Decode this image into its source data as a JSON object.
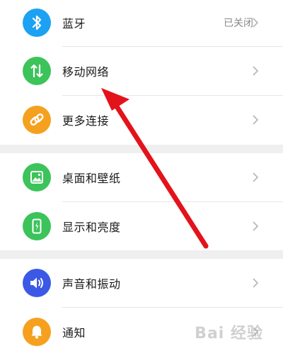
{
  "settings": {
    "items": [
      {
        "label": "蓝牙",
        "value": "已关闭",
        "icon": "bluetooth-icon",
        "color": "#1da1f2"
      },
      {
        "label": "移动网络",
        "value": "",
        "icon": "mobile-data-icon",
        "color": "#3cc35a"
      },
      {
        "label": "更多连接",
        "value": "",
        "icon": "link-icon",
        "color": "#f5a11f"
      },
      {
        "label": "桌面和壁纸",
        "value": "",
        "icon": "wallpaper-icon",
        "color": "#3cc35a"
      },
      {
        "label": "显示和亮度",
        "value": "",
        "icon": "display-brightness-icon",
        "color": "#3cc35a"
      },
      {
        "label": "声音和振动",
        "value": "",
        "icon": "volume-icon",
        "color": "#3b59e6"
      },
      {
        "label": "通知",
        "value": "",
        "icon": "bell-icon",
        "color": "#f5a11f"
      }
    ]
  },
  "annotation": {
    "color": "#e3131b"
  },
  "watermark": {
    "text": "Bai 经验"
  }
}
